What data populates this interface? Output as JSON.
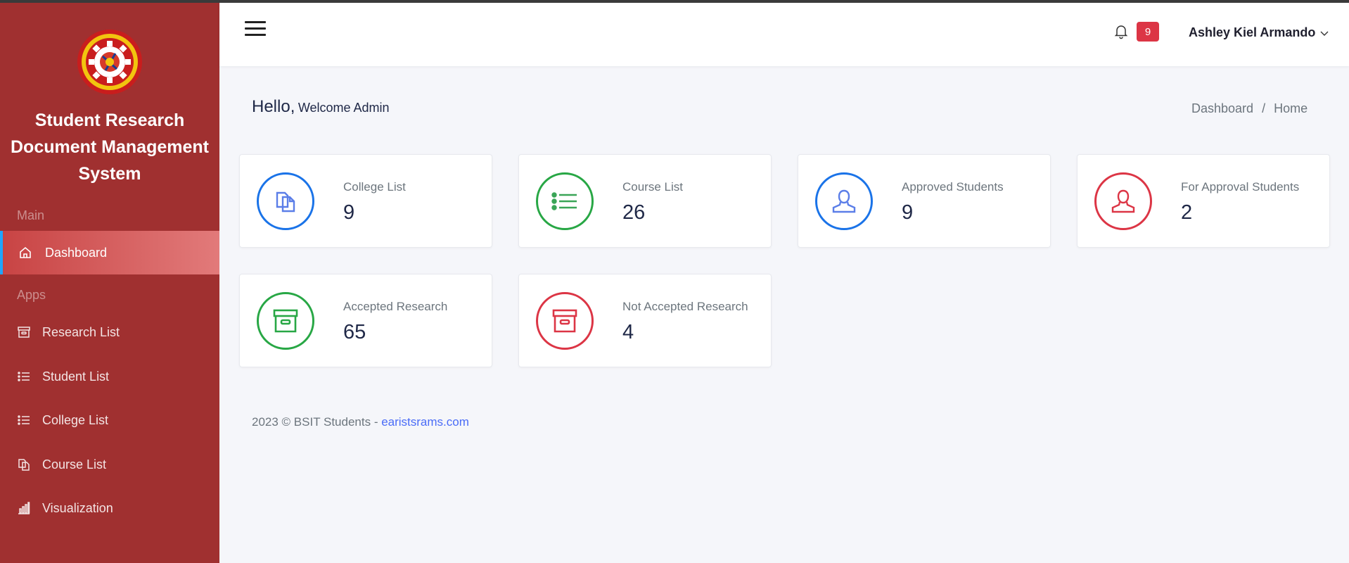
{
  "sidebar": {
    "title": "Student Research Document Management System",
    "sections": {
      "main": "Main",
      "apps": "Apps"
    },
    "items": [
      {
        "label": "Dashboard",
        "icon": "home-icon",
        "active": true
      },
      {
        "label": "Research List",
        "icon": "archive-icon"
      },
      {
        "label": "Student List",
        "icon": "list-icon"
      },
      {
        "label": "College List",
        "icon": "list-icon"
      },
      {
        "label": "Course List",
        "icon": "copy-icon"
      },
      {
        "label": "Visualization",
        "icon": "bar-chart-icon"
      }
    ]
  },
  "header": {
    "notification_count": "9",
    "user_name": "Ashley Kiel Armando"
  },
  "main": {
    "greeting": {
      "hello": "Hello,",
      "welcome": "Welcome Admin"
    },
    "breadcrumb": [
      "Dashboard",
      "/",
      "Home"
    ],
    "cards": [
      {
        "label": "College List",
        "value": "9",
        "icon": "copy-icon",
        "color": "#1a73e8"
      },
      {
        "label": "Course List",
        "value": "26",
        "icon": "list-icon",
        "color": "#28a745"
      },
      {
        "label": "Approved Students",
        "value": "9",
        "icon": "user-icon",
        "color": "#1a73e8"
      },
      {
        "label": "For Approval Students",
        "value": "2",
        "icon": "user-icon",
        "color": "#dc3545"
      },
      {
        "label": "Accepted Research",
        "value": "65",
        "icon": "archive-icon",
        "color": "#28a745"
      },
      {
        "label": "Not Accepted Research",
        "value": "4",
        "icon": "archive-icon",
        "color": "#dc3545"
      }
    ]
  },
  "footer": {
    "text": "2023 © BSIT Students - ",
    "link": "earistsrams.com"
  },
  "colors": {
    "sidebar": "#a03030",
    "accent_blue": "#1a73e8",
    "accent_green": "#28a745",
    "accent_red": "#dc3545"
  }
}
